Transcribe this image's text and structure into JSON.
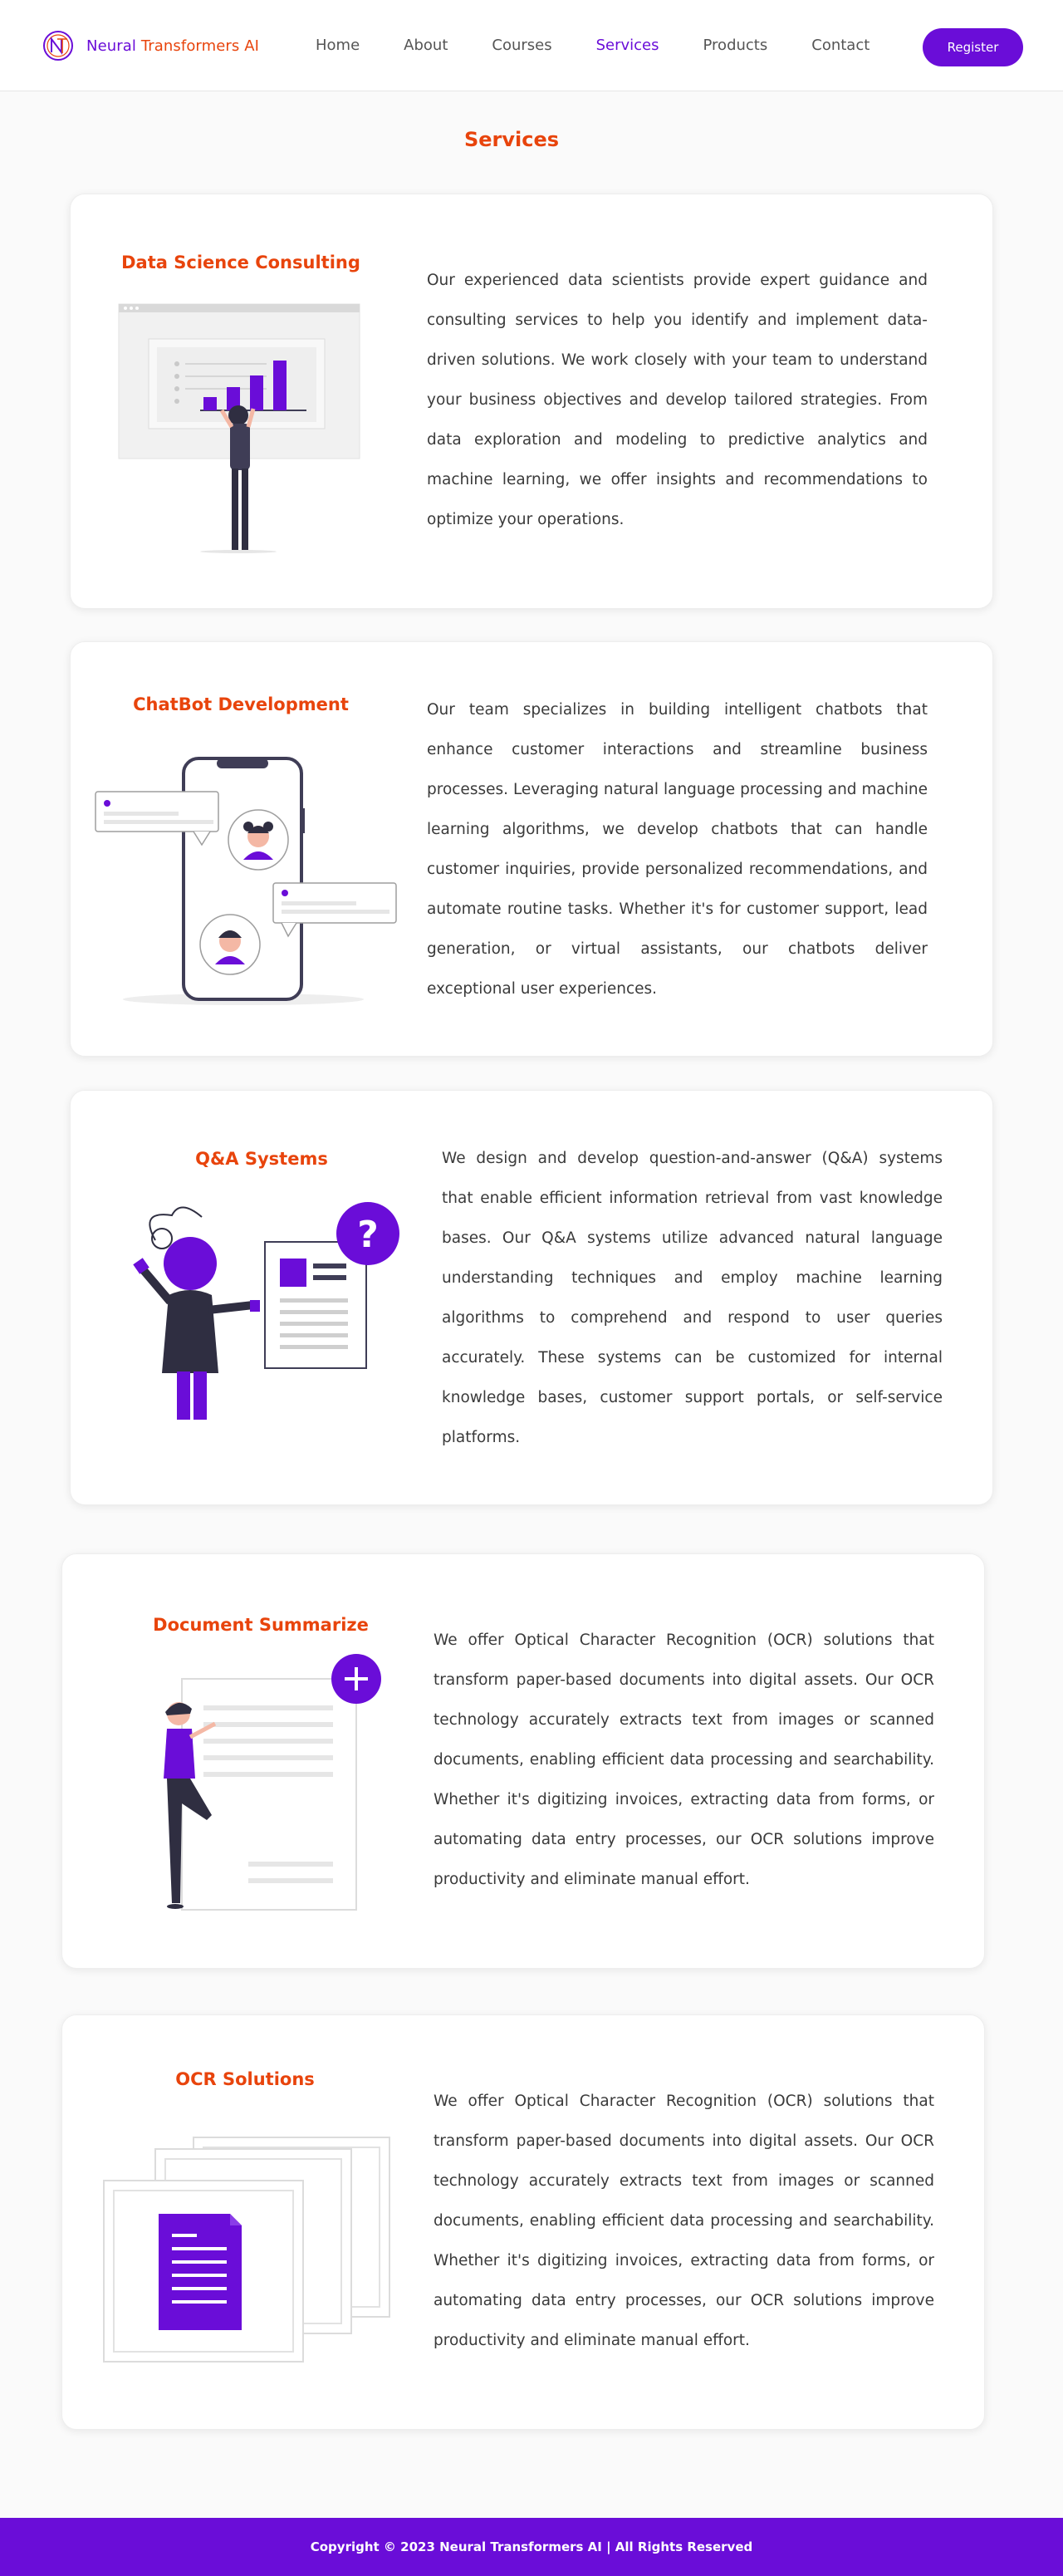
{
  "brand": {
    "name_part1": "Neural ",
    "name_part2": "Transformers AI"
  },
  "nav": {
    "items": [
      {
        "label": "Home"
      },
      {
        "label": "About"
      },
      {
        "label": "Courses"
      },
      {
        "label": "Services",
        "active": true
      },
      {
        "label": "Products"
      },
      {
        "label": "Contact"
      }
    ],
    "register_label": "Register"
  },
  "page_heading": "Services",
  "services": [
    {
      "title": "Data Science Consulting",
      "description": "Our experienced data scientists provide expert guidance and consulting services to help you identify and implement data-driven solutions. We work closely with your team to understand your business objectives and develop tailored strategies. From data exploration and modeling to predictive analytics and machine learning, we offer insights and recommendations to optimize your operations."
    },
    {
      "title": "ChatBot Development",
      "description": "Our team specializes in building intelligent chatbots that enhance customer interactions and streamline business processes. Leveraging natural language processing and machine learning algorithms, we develop chatbots that can handle customer inquiries, provide personalized recommendations, and automate routine tasks. Whether it's for customer support, lead generation, or virtual assistants, our chatbots deliver exceptional user experiences."
    },
    {
      "title": "Q&A Systems",
      "description": "We design and develop question-and-answer (Q&A) systems that enable efficient information retrieval from vast knowledge bases. Our Q&A systems utilize advanced natural language understanding techniques and employ machine learning algorithms to comprehend and respond to user queries accurately. These systems can be customized for internal knowledge bases, customer support portals, or self-service platforms."
    },
    {
      "title": "Document Summarize",
      "description": "We offer Optical Character Recognition (OCR) solutions that transform paper-based documents into digital assets. Our OCR technology accurately extracts text from images or scanned documents, enabling efficient data processing and searchability. Whether it's digitizing invoices, extracting data from forms, or automating data entry processes, our OCR solutions improve productivity and eliminate manual effort."
    },
    {
      "title": "OCR Solutions",
      "description": "We offer Optical Character Recognition (OCR) solutions that transform paper-based documents into digital assets. Our OCR technology accurately extracts text from images or scanned documents, enabling efficient data processing and searchability. Whether it's digitizing invoices, extracting data from forms, or automating data entry processes, our OCR solutions improve productivity and eliminate manual effort."
    }
  ],
  "footer": {
    "copyright": "Copyright © 2023 Neural Transformers AI | All Rights Reserved"
  },
  "colors": {
    "accent": "#6a0dd8",
    "brand_orange": "#e8440c"
  },
  "icons": [
    "logo-icon",
    "data-analysis-illustration",
    "chatbot-phone-illustration",
    "qa-illustration",
    "document-illustration",
    "ocr-illustration"
  ]
}
